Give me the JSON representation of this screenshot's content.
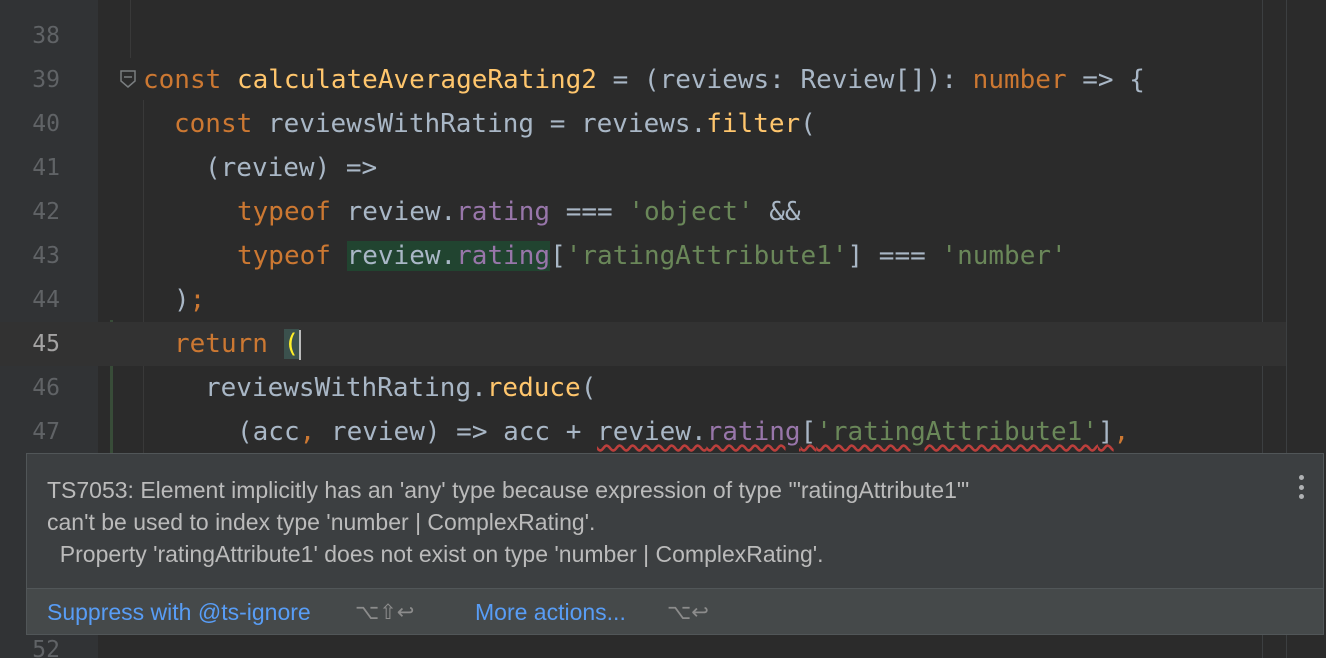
{
  "editor": {
    "lines": [
      {
        "n": "38"
      },
      {
        "n": "39"
      },
      {
        "n": "40"
      },
      {
        "n": "41"
      },
      {
        "n": "42"
      },
      {
        "n": "43"
      },
      {
        "n": "44"
      },
      {
        "n": "45"
      },
      {
        "n": "46"
      },
      {
        "n": "47"
      },
      {
        "n": "52"
      }
    ],
    "tokens": {
      "l39": [
        "const",
        " ",
        "calculateAverageRating2",
        " = (reviews: ",
        "Review",
        "[]): ",
        "number",
        " => {"
      ],
      "l40": [
        "const",
        " reviewsWithRating = reviews.",
        "filter",
        "("
      ],
      "l41": [
        "(review) =>"
      ],
      "l42": [
        "typeof",
        " review.",
        "rating",
        " === ",
        "'object'",
        " &&"
      ],
      "l43": [
        "typeof",
        " ",
        "review.",
        "rating",
        "[",
        "'ratingAttribute1'",
        "] === ",
        "'number'"
      ],
      "l44": [
        ")",
        ";"
      ],
      "l45": [
        "return",
        " ",
        "("
      ],
      "l46": [
        "reviewsWithRating.",
        "reduce",
        "("
      ],
      "l47": [
        "(acc",
        ",",
        " review) => acc + ",
        "review.",
        "rating",
        "[",
        "'ratingAttribute1'",
        "]",
        ","
      ]
    },
    "current_line": "45"
  },
  "popup": {
    "message_lines": [
      "TS7053: Element implicitly has an 'any' type because expression of type '\"ratingAttribute1\"'",
      "can't be used to index type 'number | ComplexRating'.",
      "  Property 'ratingAttribute1' does not exist on type 'number | ComplexRating'."
    ],
    "actions": [
      {
        "label": "Suppress with @ts-ignore",
        "shortcut": "⌥⇧↩"
      },
      {
        "label": "More actions...",
        "shortcut": "⌥↩"
      }
    ],
    "menu_icon": "vertical-dots-icon"
  },
  "colors": {
    "background": "#2b2b2b",
    "keyword": "#cc7832",
    "function": "#ffc66d",
    "string": "#6a8759",
    "property": "#9876aa",
    "link": "#589df6"
  }
}
